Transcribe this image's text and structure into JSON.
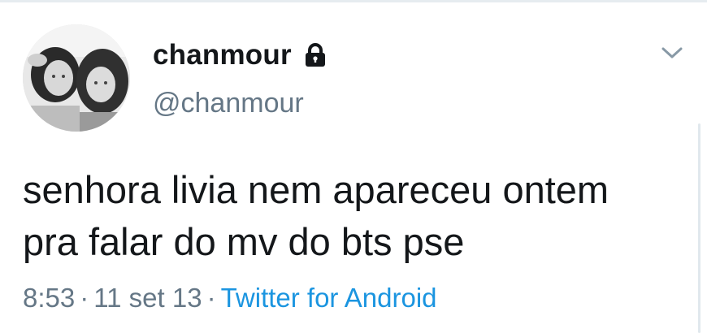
{
  "author": {
    "display_name": "chanmour",
    "handle": "@chanmour",
    "protected_icon": "lock-icon",
    "avatar_icon": "avatar-photo"
  },
  "menu": {
    "icon": "chevron-down-icon"
  },
  "tweet": {
    "lines": [
      "senhora livia nem apareceu ontem",
      "pra falar do mv do bts pse"
    ],
    "time": "8:53",
    "date": "11 set 13",
    "separator": "·",
    "source": "Twitter for Android"
  },
  "colors": {
    "text": "#14171a",
    "secondary": "#657786",
    "link": "#1b95e0"
  }
}
